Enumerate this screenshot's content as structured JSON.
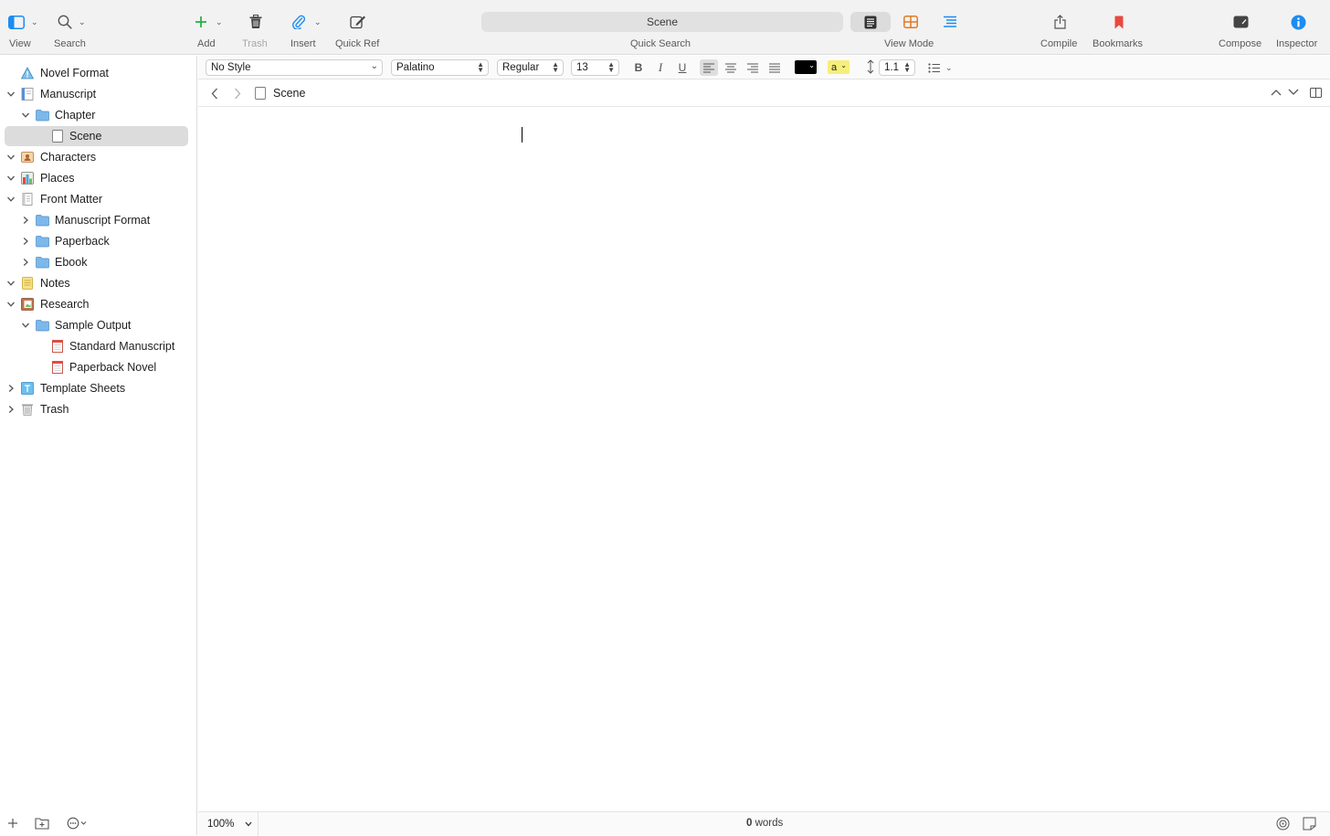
{
  "toolbar": {
    "view_label": "View",
    "search_label": "Search",
    "add_label": "Add",
    "trash_label": "Trash",
    "insert_label": "Insert",
    "quickref_label": "Quick Ref",
    "quick_search_value": "Scene",
    "quick_search_label": "Quick Search",
    "view_mode_label": "View Mode",
    "compile_label": "Compile",
    "bookmarks_label": "Bookmarks",
    "compose_label": "Compose",
    "inspector_label": "Inspector"
  },
  "binder": {
    "items": [
      {
        "name": "Novel Format"
      },
      {
        "name": "Manuscript"
      },
      {
        "name": "Chapter"
      },
      {
        "name": "Scene"
      },
      {
        "name": "Characters"
      },
      {
        "name": "Places"
      },
      {
        "name": "Front Matter"
      },
      {
        "name": "Manuscript Format"
      },
      {
        "name": "Paperback"
      },
      {
        "name": "Ebook"
      },
      {
        "name": "Notes"
      },
      {
        "name": "Research"
      },
      {
        "name": "Sample Output"
      },
      {
        "name": "Standard Manuscript"
      },
      {
        "name": "Paperback Novel"
      },
      {
        "name": "Template Sheets"
      },
      {
        "name": "Trash"
      }
    ]
  },
  "formatbar": {
    "paragraph_style": "No Style",
    "font_family": "Palatino",
    "font_weight": "Regular",
    "font_size": "13",
    "bold": "B",
    "italic": "I",
    "underline": "U",
    "highlight_glyph": "a",
    "line_spacing": "1.1"
  },
  "header": {
    "doc_title": "Scene"
  },
  "footer": {
    "zoom": "100%",
    "word_count": "0",
    "word_unit": "words"
  },
  "colors": {
    "accent_green": "#27b14a",
    "accent_blue": "#1b8cf2",
    "bookmark_red": "#e9483f",
    "corkboard_orange": "#e07b26",
    "folder_blue": "#7db8ea",
    "highlight_yellow": "#f6ef7a"
  }
}
